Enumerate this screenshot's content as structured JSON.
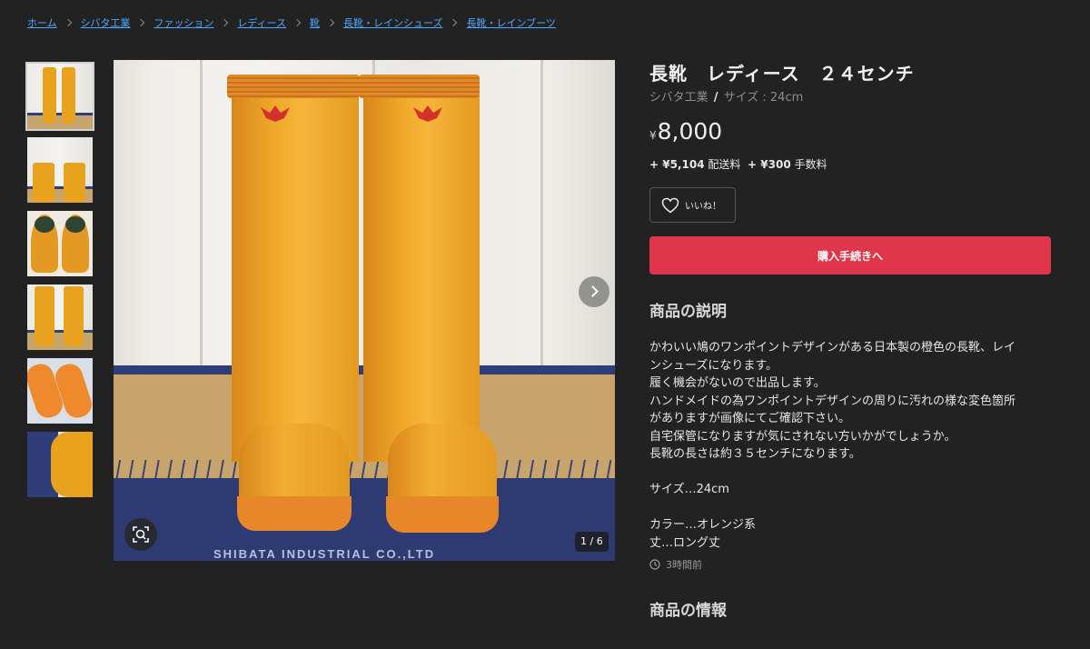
{
  "breadcrumb": [
    "ホーム",
    "シバタ工業",
    "ファッション",
    "レディース",
    "靴",
    "長靴・レインシューズ",
    "長靴・レインブーツ"
  ],
  "product": {
    "title": "長靴　レディース　２４センチ",
    "brand": "シバタ工業",
    "size_label": "サイズ : 24cm",
    "currency_symbol": "¥",
    "price": "8,000",
    "fees": {
      "shipping_amount": "+ ¥5,104",
      "shipping_label": "配送料",
      "fee_amount": "+ ¥300",
      "fee_label": "手数料"
    },
    "like_label": "いいね！",
    "buy_label": "購入手続きへ"
  },
  "gallery": {
    "counter": "1 / 6",
    "thumbnail_count": 6,
    "box_text": "SHIBATA INDUSTRIAL CO.,LTD",
    "icons": {
      "next": "chevron-right-icon",
      "zoom": "zoom-scan-icon",
      "like": "heart-icon",
      "time": "clock-icon"
    }
  },
  "description": {
    "heading": "商品の説明",
    "lines": [
      "かわいい鳩のワンポイントデザインがある日本製の橙色の長靴、レイ",
      "ンシューズになります。",
      "履く機会がないので出品します。",
      "ハンドメイドの為ワンポイントデザインの周りに汚れの様な変色箇所",
      "がありますが画像にてご確認下さい。",
      "自宅保管になりますが気にされない方いかがでしょうか。",
      "長靴の長さは約３５センチになります。",
      "",
      "サイズ…24cm",
      "",
      "カラー…オレンジ系",
      "丈…ロング丈"
    ],
    "posted_time": "3時間前"
  },
  "info_heading": "商品の情報",
  "colors": {
    "background": "#222222",
    "link": "#4ea8ff",
    "buy_button": "#e0364b",
    "boot": "#f0aa2a"
  }
}
